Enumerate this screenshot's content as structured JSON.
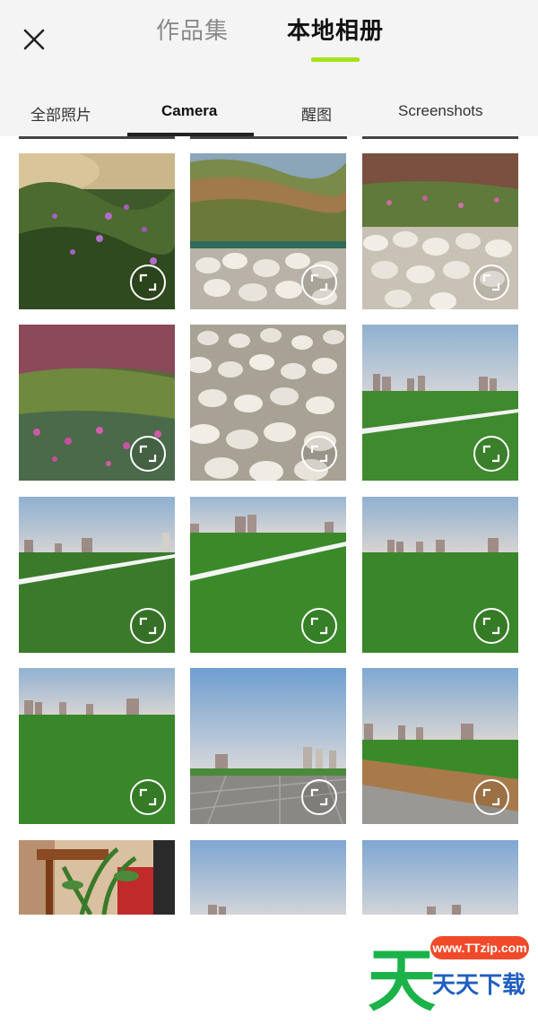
{
  "header": {
    "tabs": [
      {
        "label": "作品集",
        "active": false
      },
      {
        "label": "本地相册",
        "active": true
      }
    ]
  },
  "album_tabs": [
    {
      "label": "全部照片",
      "active": false
    },
    {
      "label": "Camera",
      "active": true
    },
    {
      "label": "醒图",
      "active": false
    },
    {
      "label": "Screenshots",
      "active": false
    }
  ],
  "colors": {
    "accent": "#a6e21b",
    "active_indicator": "#222222",
    "header_bg": "#f4f4f4"
  },
  "icons": {
    "close": "close-icon",
    "expand": "expand-icon"
  },
  "photos": [
    {
      "scene": "purple-flowers"
    },
    {
      "scene": "grass-and-pebbles"
    },
    {
      "scene": "flowers-and-pebbles"
    },
    {
      "scene": "flower-bed"
    },
    {
      "scene": "pebbles"
    },
    {
      "scene": "field-with-line"
    },
    {
      "scene": "field-with-line"
    },
    {
      "scene": "field-with-line"
    },
    {
      "scene": "field-skyline"
    },
    {
      "scene": "field-skyline"
    },
    {
      "scene": "plaza-skyline"
    },
    {
      "scene": "field-path"
    },
    {
      "scene": "balcony-plant"
    },
    {
      "scene": "sky-skyline"
    },
    {
      "scene": "sky-skyline"
    }
  ],
  "watermark": {
    "logo_char": "天",
    "url": "www.TTzip.com",
    "name": "天天下载"
  }
}
